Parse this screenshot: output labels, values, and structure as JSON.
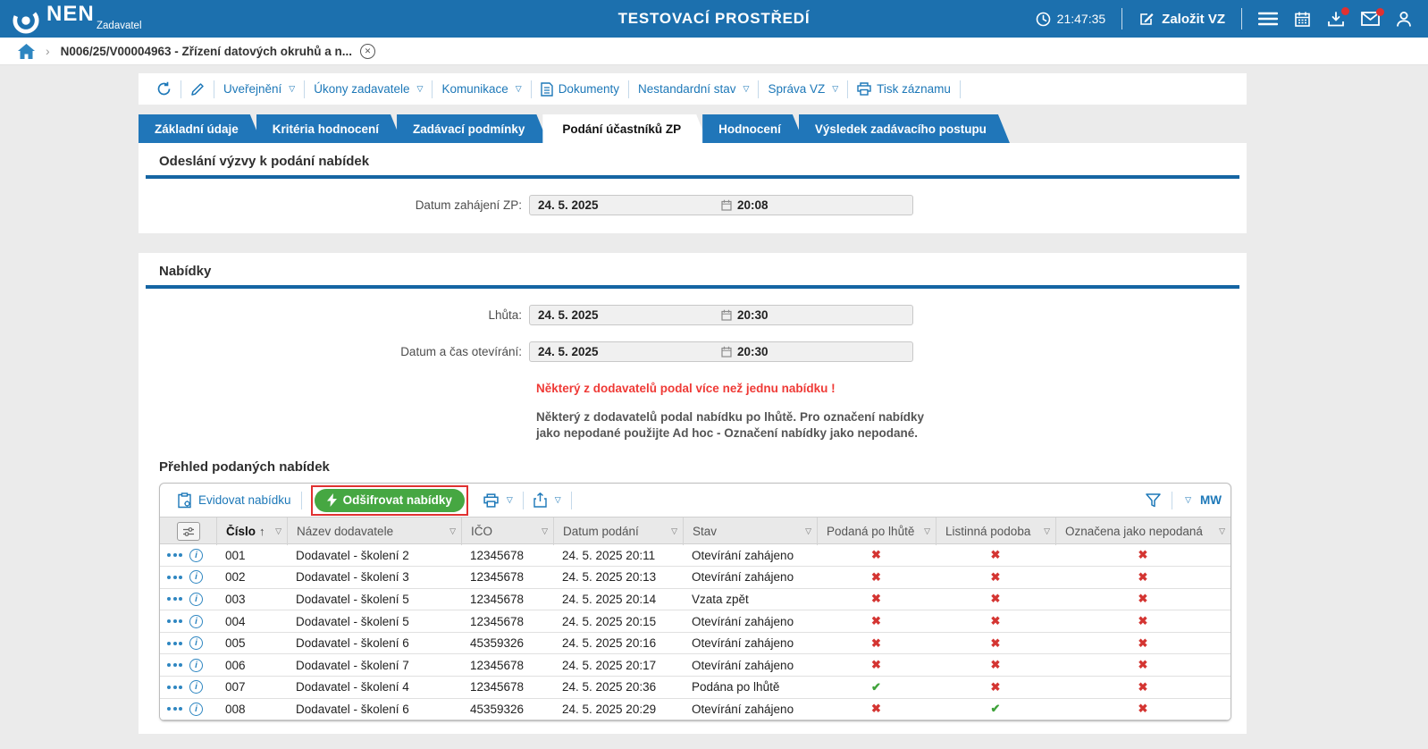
{
  "topbar": {
    "brand": {
      "name": "NEN",
      "subtitle": "Zadavatel"
    },
    "env_title": "TESTOVACÍ PROSTŘEDÍ",
    "clock": "21:47:35",
    "create_vz_label": "Založit VZ"
  },
  "breadcrumb": {
    "item": "N006/25/V00004963 - Zřízení datových okruhů a n..."
  },
  "record_toolbar": {
    "uverejneni": "Uveřejnění",
    "ukony": "Úkony zadavatele",
    "komunikace": "Komunikace",
    "dokumenty": "Dokumenty",
    "nestandardni": "Nestandardní stav",
    "sprava": "Správa VZ",
    "tisk": "Tisk záznamu"
  },
  "tabs": {
    "items": [
      {
        "label": "Základní údaje",
        "active": false
      },
      {
        "label": "Kritéria hodnocení",
        "active": false
      },
      {
        "label": "Zadávací podmínky",
        "active": false
      },
      {
        "label": "Podání účastníků ZP",
        "active": true
      },
      {
        "label": "Hodnocení",
        "active": false
      },
      {
        "label": "Výsledek zadávacího postupu",
        "active": false
      }
    ]
  },
  "section_odeslani": {
    "title": "Odeslání výzvy k podání nabídek",
    "field": {
      "label": "Datum zahájení ZP:",
      "date": "24. 5. 2025",
      "time": "20:08"
    }
  },
  "section_nabidky": {
    "title": "Nabídky",
    "lhuta": {
      "label": "Lhůta:",
      "date": "24. 5. 2025",
      "time": "20:30"
    },
    "oteviani": {
      "label": "Datum a čas otevírání:",
      "date": "24. 5. 2025",
      "time": "20:30"
    },
    "warning_red": "Některý z dodavatelů podal více než jednu nabídku !",
    "warning_grey": "Některý z dodavatelů podal nabídku po lhůtě. Pro označení nabídky jako nepodané použijte Ad hoc - Označení nabídky jako nepodané."
  },
  "table": {
    "title": "Přehled podaných nabídek",
    "toolbar": {
      "evidovat": "Evidovat nabídku",
      "odsifrovat": "Odšifrovat nabídky",
      "mw": "MW"
    },
    "columns": [
      {
        "label": "Číslo"
      },
      {
        "label": "Název dodavatele"
      },
      {
        "label": "IČO"
      },
      {
        "label": "Datum podání"
      },
      {
        "label": "Stav"
      },
      {
        "label": "Podaná po lhůtě"
      },
      {
        "label": "Listinná podoba"
      },
      {
        "label": "Označena jako nepodaná"
      }
    ],
    "rows": [
      {
        "cislo": "001",
        "nazev": "Dodavatel - školení 2",
        "ico": "12345678",
        "datum": "24. 5. 2025 20:11",
        "stav": "Otevírání zahájeno",
        "podana_po_lhute": false,
        "listinna_podoba": false,
        "oznacena_nepodana": false
      },
      {
        "cislo": "002",
        "nazev": "Dodavatel - školení 3",
        "ico": "12345678",
        "datum": "24. 5. 2025 20:13",
        "stav": "Otevírání zahájeno",
        "podana_po_lhute": false,
        "listinna_podoba": false,
        "oznacena_nepodana": false
      },
      {
        "cislo": "003",
        "nazev": "Dodavatel - školení 5",
        "ico": "12345678",
        "datum": "24. 5. 2025 20:14",
        "stav": "Vzata zpět",
        "podana_po_lhute": false,
        "listinna_podoba": false,
        "oznacena_nepodana": false
      },
      {
        "cislo": "004",
        "nazev": "Dodavatel - školení 5",
        "ico": "12345678",
        "datum": "24. 5. 2025 20:15",
        "stav": "Otevírání zahájeno",
        "podana_po_lhute": false,
        "listinna_podoba": false,
        "oznacena_nepodana": false
      },
      {
        "cislo": "005",
        "nazev": "Dodavatel - školení 6",
        "ico": "45359326",
        "datum": "24. 5. 2025 20:16",
        "stav": "Otevírání zahájeno",
        "podana_po_lhute": false,
        "listinna_podoba": false,
        "oznacena_nepodana": false
      },
      {
        "cislo": "006",
        "nazev": "Dodavatel - školení 7",
        "ico": "12345678",
        "datum": "24. 5. 2025 20:17",
        "stav": "Otevírání zahájeno",
        "podana_po_lhute": false,
        "listinna_podoba": false,
        "oznacena_nepodana": false
      },
      {
        "cislo": "007",
        "nazev": "Dodavatel - školení 4",
        "ico": "12345678",
        "datum": "24. 5. 2025 20:36",
        "stav": "Podána po lhůtě",
        "podana_po_lhute": true,
        "listinna_podoba": false,
        "oznacena_nepodana": false
      },
      {
        "cislo": "008",
        "nazev": "Dodavatel - školení 6",
        "ico": "45359326",
        "datum": "24. 5. 2025 20:29",
        "stav": "Otevírání zahájeno",
        "podana_po_lhute": false,
        "listinna_podoba": true,
        "oznacena_nepodana": false
      }
    ]
  },
  "icons": {
    "check": "✔",
    "cross": "✖",
    "sort_asc": "↑",
    "filter_dropdown": "▽",
    "breadcrumb_chevron": "›",
    "close": "✕",
    "info": "i"
  },
  "colors": {
    "topbar_blue": "#1c70ae",
    "tab_blue": "#2076b9",
    "accent_link": "#1d78b8",
    "section_rule": "#1565a3",
    "warning_red": "#ef3a36",
    "cross_red": "#d43532",
    "check_green": "#3fa23a",
    "decrypt_green": "#46a742",
    "highlight_red": "#e03131",
    "page_bg": "#ebebeb"
  }
}
